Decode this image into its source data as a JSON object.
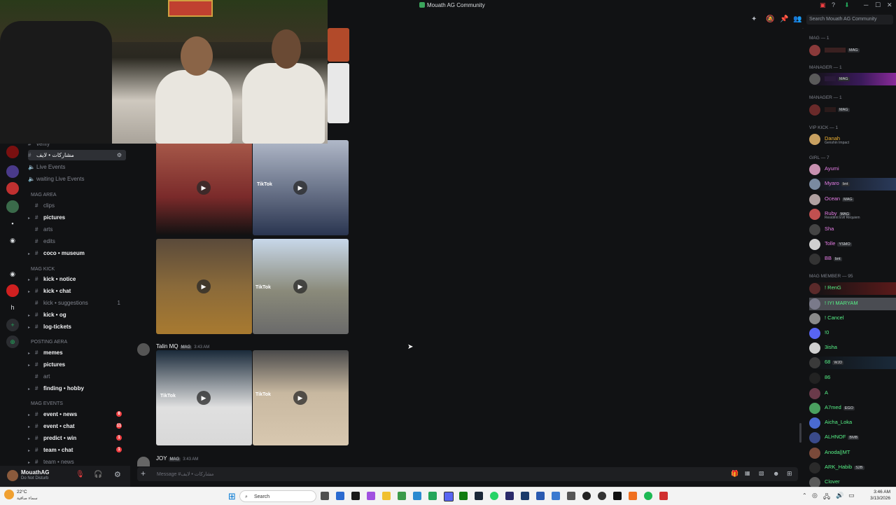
{
  "window": {
    "title": "Mouath AG Community",
    "search_placeholder": "Search Mouath AG Community"
  },
  "channels": {
    "top": [
      {
        "label": "verify",
        "state": "dim"
      },
      {
        "label": "مشاركات • لايف",
        "state": "selected"
      },
      {
        "label": "Live Events",
        "state": "dim"
      },
      {
        "label": "waiting Live Events",
        "state": "dim"
      }
    ],
    "categories": [
      {
        "name": "MAG AREA",
        "items": [
          {
            "label": "clips",
            "state": "dim"
          },
          {
            "label": "pictures",
            "state": "bright"
          },
          {
            "label": "arts",
            "state": "dim"
          },
          {
            "label": "edits",
            "state": "dim"
          },
          {
            "label": "coco • museum",
            "state": "bright"
          }
        ]
      },
      {
        "name": "MAG KICK",
        "items": [
          {
            "label": "kick • notice",
            "state": "bright"
          },
          {
            "label": "kick • chat",
            "state": "bright"
          },
          {
            "label": "kick • suggestions",
            "state": "dim",
            "count": "1"
          },
          {
            "label": "kick • og",
            "state": "bright"
          },
          {
            "label": "log-tickets",
            "state": "bright"
          }
        ]
      },
      {
        "name": "POSTING AERA",
        "items": [
          {
            "label": "memes",
            "state": "bright"
          },
          {
            "label": "pictures",
            "state": "bright"
          },
          {
            "label": "art",
            "state": "dim"
          },
          {
            "label": "finding • hobby",
            "state": "bright"
          }
        ]
      },
      {
        "name": "MAG EVENTS",
        "items": [
          {
            "label": "event • news",
            "state": "bright",
            "badge": "8"
          },
          {
            "label": "event • chat",
            "state": "bright",
            "badge": "11"
          },
          {
            "label": "predict • win",
            "state": "bright",
            "badge": "1"
          },
          {
            "label": "team • chat",
            "state": "bright",
            "badge": "1"
          },
          {
            "label": "team • news",
            "state": "dim"
          }
        ]
      }
    ]
  },
  "user_panel": {
    "name": "MouathAG",
    "status": "Do Not Disturb"
  },
  "chat": {
    "messages": [
      {
        "author": "Talin MQ",
        "tag": "MAG",
        "time": "3:43 AM"
      },
      {
        "author": "JOY",
        "tag": "MAG",
        "time": "3:43 AM"
      }
    ],
    "thumb_text": [
      "TikTok",
      "TikTok",
      "TikTok",
      "TikTok",
      "TikTok"
    ],
    "composer_placeholder": "Message #مشاركات • لايف"
  },
  "members": {
    "groups": [
      {
        "name": "MAG — 1",
        "members": [
          {
            "name": "",
            "tag": "MAG",
            "color": "#dbdee1"
          }
        ]
      },
      {
        "name": "MANAGER — 1",
        "members": [
          {
            "name": "",
            "tag": "MAG",
            "color": "#dbdee1"
          }
        ]
      },
      {
        "name": "MANAGER — 1",
        "members": [
          {
            "name": "",
            "tag": "MAG",
            "color": "#dbdee1"
          }
        ]
      },
      {
        "name": "VIP kick — 1",
        "members": [
          {
            "name": "Danah",
            "tag": "",
            "sub": "Genshin Impact",
            "color": "#f0b232"
          }
        ]
      },
      {
        "name": "girl — 7",
        "members": [
          {
            "name": "Ayumi",
            "tag": "",
            "color": "#e67ee6"
          },
          {
            "name": "Myaro",
            "tag": "bnt",
            "color": "#e67ee6"
          },
          {
            "name": "Ocean",
            "tag": "MAG",
            "color": "#e67ee6"
          },
          {
            "name": "Ruby",
            "tag": "MAG",
            "sub": "Resident Evil Requiem",
            "color": "#e67ee6"
          },
          {
            "name": "Sha",
            "tag": "",
            "color": "#e67ee6"
          },
          {
            "name": "Tolle",
            "tag": "YSMO",
            "color": "#e67ee6"
          },
          {
            "name": "BB",
            "tag": "bnt",
            "color": "#e67ee6"
          }
        ]
      },
      {
        "name": "MAG member — 95",
        "members": [
          {
            "name": "! RenG",
            "tag": "",
            "color": "#57f287"
          },
          {
            "name": "! IYI MARYAM",
            "tag": "",
            "color": "#57f287"
          },
          {
            "name": "! Cancel",
            "tag": "",
            "color": "#57f287"
          },
          {
            "name": "!0",
            "tag": "",
            "color": "#57f287"
          },
          {
            "name": "3isha",
            "tag": "",
            "color": "#57f287"
          },
          {
            "name": "68",
            "tag": "WJD",
            "color": "#57f287"
          },
          {
            "name": "86",
            "tag": "",
            "color": "#57f287"
          },
          {
            "name": "A",
            "tag": "",
            "color": "#57f287"
          },
          {
            "name": "A7med",
            "tag": "EGO",
            "color": "#57f287"
          },
          {
            "name": "Aicha_Loka",
            "tag": "",
            "color": "#57f287"
          },
          {
            "name": "ALHNOF",
            "tag": "BMB",
            "color": "#57f287"
          },
          {
            "name": "Anoda||MT",
            "tag": "",
            "color": "#57f287"
          },
          {
            "name": "ARK_Habib",
            "tag": "S2B",
            "color": "#57f287"
          },
          {
            "name": "Clover",
            "tag": "",
            "color": "#57f287"
          }
        ]
      }
    ]
  },
  "taskbar": {
    "weather_temp": "22°C",
    "weather_desc": "سماء صافية",
    "search_label": "Search",
    "time": "3:46 AM",
    "date": "3/13/2026"
  },
  "colors": {
    "accent": "#5865f2",
    "red": "#f23f42",
    "green": "#23a55a"
  }
}
